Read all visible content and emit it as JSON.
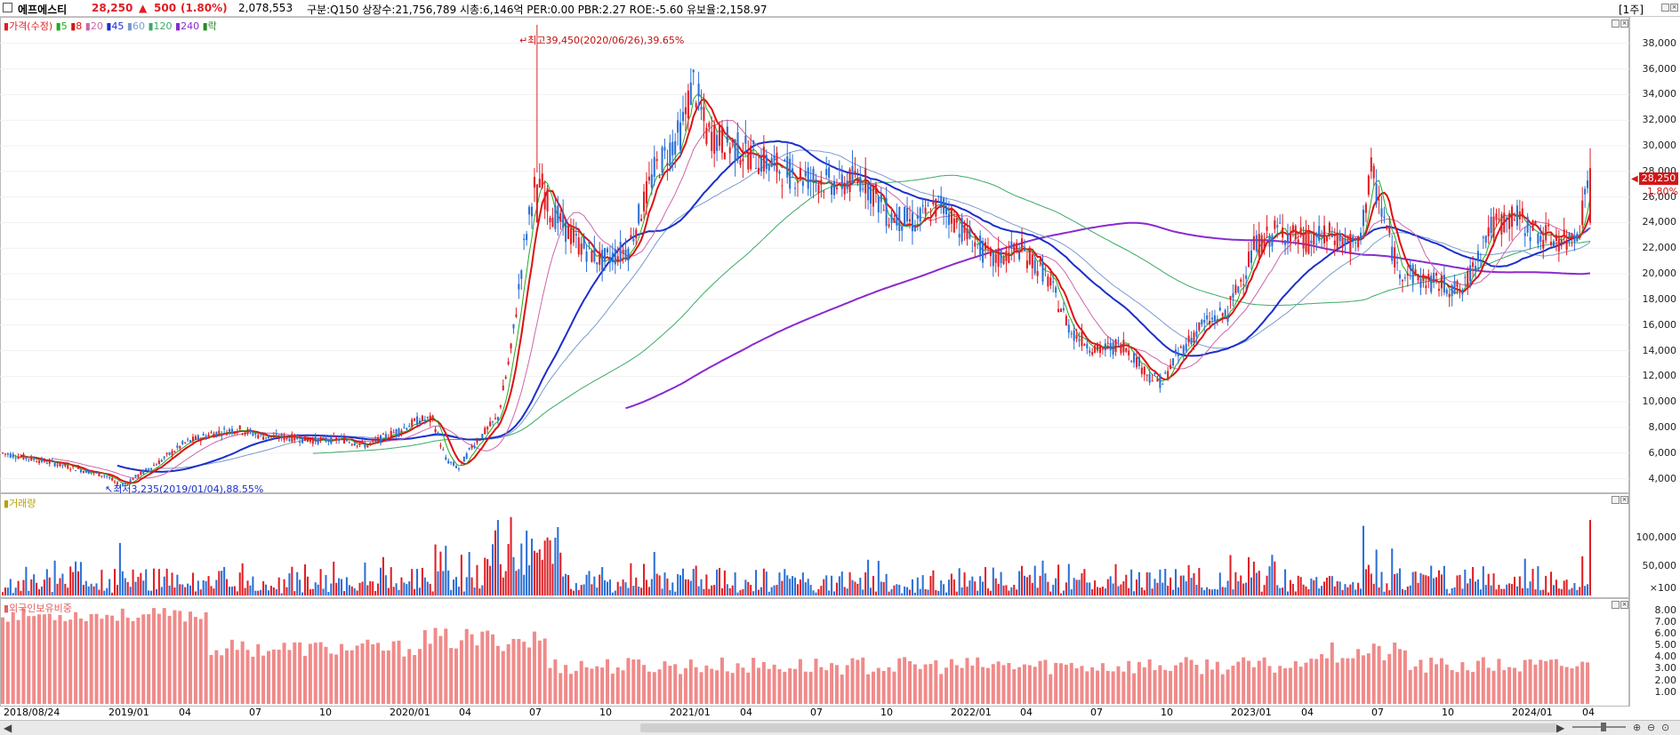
{
  "header": {
    "name": "에프에스티",
    "price": "28,250",
    "change_arrow": "▲",
    "change": "500",
    "change_pct": "(1.80%)",
    "volume": "2,078,553",
    "info": "구분:Q150 상장수:21,756,789 시총:6,146억 PER:0.00 PBR:2.27 ROE:-5.60 유보율:2,158.97",
    "period": "[1주]"
  },
  "legend": {
    "price_label": "가격(수정)",
    "ma5": "5",
    "ma8": "8",
    "ma20": "20",
    "ma45": "45",
    "ma60": "60",
    "ma120": "120",
    "ma240": "240",
    "rak": "락",
    "volume_label": "거래량",
    "foreign_label": "외국인보유비중"
  },
  "annotations": {
    "high": "최고39,450(2020/06/26),39.65%",
    "low": "최저3,235(2019/01/04),88.55%",
    "last_price": "28,250",
    "last_pct": "1.80%"
  },
  "colors": {
    "up": "#e01e24",
    "down": "#2b6fd6",
    "ma5": "#22aa22",
    "ma8": "#dd1111",
    "ma20": "#cc66aa",
    "ma45": "#1a2fcc",
    "ma60": "#7a9bd0",
    "ma120": "#3aaa66",
    "ma240": "#8a2ad0",
    "foreign": "#f08a8a"
  },
  "chart_data": [
    {
      "type": "candlestick",
      "title": "가격(수정)",
      "ylim": [
        3000,
        40000
      ],
      "yticks": [
        "4,000",
        "6,000",
        "8,000",
        "10,000",
        "12,000",
        "14,000",
        "16,000",
        "18,000",
        "20,000",
        "22,000",
        "24,000",
        "26,000",
        "28,000",
        "30,000",
        "32,000",
        "34,000",
        "36,000",
        "38,000"
      ],
      "x_labels": [
        "2018/08/24",
        "2019/01",
        "04",
        "07",
        "10",
        "2020/01",
        "04",
        "07",
        "10",
        "2021/01",
        "04",
        "07",
        "10",
        "2022/01",
        "04",
        "07",
        "10",
        "2023/01",
        "04",
        "07",
        "10",
        "2024/01",
        "04"
      ],
      "close_series_approx": [
        [
          0,
          6000
        ],
        [
          20,
          5200
        ],
        [
          40,
          4200
        ],
        [
          45,
          3400
        ],
        [
          50,
          4000
        ],
        [
          60,
          5300
        ],
        [
          70,
          6800
        ],
        [
          80,
          7500
        ],
        [
          90,
          7900
        ],
        [
          100,
          7300
        ],
        [
          110,
          7200
        ],
        [
          120,
          7000
        ],
        [
          130,
          7100
        ],
        [
          140,
          6600
        ],
        [
          150,
          7600
        ],
        [
          160,
          8600
        ],
        [
          165,
          8600
        ],
        [
          170,
          5500
        ],
        [
          175,
          4800
        ],
        [
          180,
          6500
        ],
        [
          190,
          8800
        ],
        [
          195,
          14000
        ],
        [
          200,
          22000
        ],
        [
          205,
          28000
        ],
        [
          210,
          25000
        ],
        [
          220,
          22500
        ],
        [
          230,
          21000
        ],
        [
          240,
          22000
        ],
        [
          250,
          28000
        ],
        [
          260,
          31000
        ],
        [
          265,
          35000
        ],
        [
          270,
          31000
        ],
        [
          280,
          30000
        ],
        [
          290,
          29000
        ],
        [
          300,
          28000
        ],
        [
          310,
          27500
        ],
        [
          320,
          27000
        ],
        [
          330,
          27500
        ],
        [
          340,
          24500
        ],
        [
          350,
          24000
        ],
        [
          360,
          25500
        ],
        [
          370,
          23000
        ],
        [
          380,
          21000
        ],
        [
          390,
          22000
        ],
        [
          400,
          20000
        ],
        [
          410,
          15500
        ],
        [
          420,
          14000
        ],
        [
          430,
          14500
        ],
        [
          440,
          12000
        ],
        [
          445,
          11500
        ],
        [
          450,
          13500
        ],
        [
          460,
          16000
        ],
        [
          470,
          17000
        ],
        [
          480,
          22000
        ],
        [
          490,
          23500
        ],
        [
          500,
          22500
        ],
        [
          510,
          23000
        ],
        [
          520,
          22000
        ],
        [
          525,
          28000
        ],
        [
          535,
          20500
        ],
        [
          545,
          19500
        ],
        [
          555,
          19000
        ],
        [
          560,
          18500
        ],
        [
          570,
          23500
        ],
        [
          580,
          24500
        ],
        [
          590,
          23000
        ],
        [
          600,
          22500
        ],
        [
          605,
          23800
        ],
        [
          609,
          28250
        ]
      ],
      "high": {
        "value": 39450,
        "date": "2020/06/26"
      },
      "low": {
        "value": 3235,
        "date": "2019/01/04"
      },
      "last": 28250
    },
    {
      "type": "bar",
      "title": "거래량",
      "yticks": [
        "×100",
        "50,000",
        "100,000"
      ],
      "ylim": [
        0,
        150000
      ]
    },
    {
      "type": "bar",
      "title": "외국인보유비중",
      "yticks": [
        "1.00",
        "2.00",
        "3.00",
        "4.00",
        "5.00",
        "6.00",
        "7.00",
        "8.00"
      ],
      "ylim": [
        0,
        8.5
      ]
    }
  ]
}
